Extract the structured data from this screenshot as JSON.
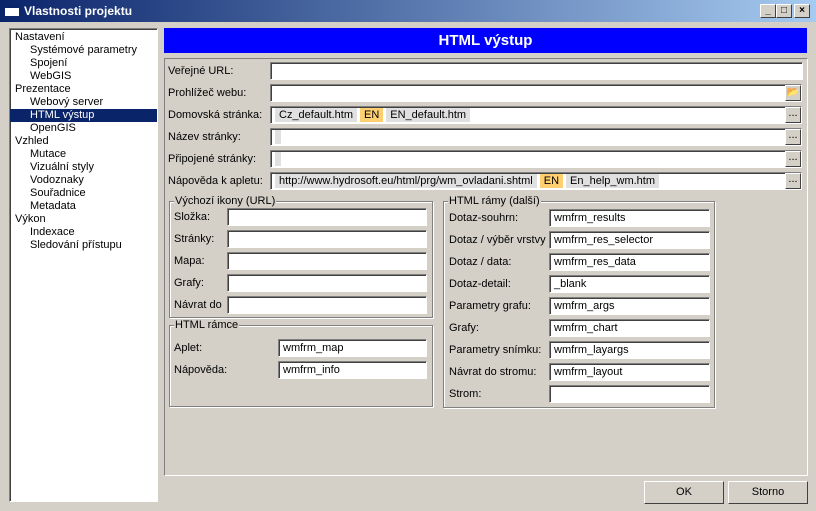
{
  "window": {
    "title": "Vlastnosti projektu",
    "minimize": "_",
    "maximize": "□",
    "close": "×"
  },
  "sidebar": {
    "items": [
      {
        "label": "Nastavení",
        "level": 0
      },
      {
        "label": "Systémové parametry",
        "level": 1
      },
      {
        "label": "Spojení",
        "level": 1
      },
      {
        "label": "WebGIS",
        "level": 1
      },
      {
        "label": "Prezentace",
        "level": 0
      },
      {
        "label": "Webový server",
        "level": 1
      },
      {
        "label": "HTML výstup",
        "level": 1,
        "selected": true
      },
      {
        "label": "OpenGIS",
        "level": 1
      },
      {
        "label": "Vzhled",
        "level": 0
      },
      {
        "label": "Mutace",
        "level": 1
      },
      {
        "label": "Vizuální styly",
        "level": 1
      },
      {
        "label": "Vodoznaky",
        "level": 1
      },
      {
        "label": "Souřadnice",
        "level": 1
      },
      {
        "label": "Metadata",
        "level": 1
      },
      {
        "label": "Výkon",
        "level": 0
      },
      {
        "label": "Indexace",
        "level": 1
      },
      {
        "label": "Sledování přístupu",
        "level": 1
      }
    ]
  },
  "header": {
    "title": "HTML výstup"
  },
  "fields": {
    "public_url": {
      "label": "Veřejné URL:",
      "value": ""
    },
    "browser": {
      "label": "Prohlížeč webu:",
      "value": ""
    },
    "home": {
      "label": "Domovská stránka:",
      "cz": "Cz_default.htm",
      "lang": "EN",
      "en": "EN_default.htm"
    },
    "page_name": {
      "label": "Název stránky:",
      "value": ""
    },
    "attached": {
      "label": "Připojené stránky:",
      "value": ""
    },
    "applet_help": {
      "label": "Nápověda k apletu:",
      "cz": "http://www.hydrosoft.eu/html/prg/wm_ovladani.shtml",
      "lang": "EN",
      "en": "En_help_wm.htm"
    },
    "dots": "..."
  },
  "icons_group": {
    "title": "Výchozí ikony (URL)",
    "rows": [
      {
        "label": "Složka:",
        "value": ""
      },
      {
        "label": "Stránky:",
        "value": ""
      },
      {
        "label": "Mapa:",
        "value": ""
      },
      {
        "label": "Grafy:",
        "value": ""
      },
      {
        "label": "Návrat do",
        "value": ""
      }
    ]
  },
  "frames_group": {
    "title": "HTML rámce",
    "rows": [
      {
        "label": "Aplet:",
        "value": "wmfrm_map"
      },
      {
        "label": "Nápověda:",
        "value": "wmfrm_info"
      }
    ]
  },
  "more_group": {
    "title": "HTML rámy (další)",
    "rows": [
      {
        "label": "Dotaz-souhrn:",
        "value": "wmfrm_results"
      },
      {
        "label": "Dotaz / výběr vrstvy",
        "value": "wmfrm_res_selector"
      },
      {
        "label": "Dotaz / data:",
        "value": "wmfrm_res_data"
      },
      {
        "label": "Dotaz-detail:",
        "value": "_blank"
      },
      {
        "label": "Parametry grafu:",
        "value": "wmfrm_args"
      },
      {
        "label": "Grafy:",
        "value": "wmfrm_chart"
      },
      {
        "label": "Parametry snímku:",
        "value": "wmfrm_layargs"
      },
      {
        "label": "Návrat do stromu:",
        "value": "wmfrm_layout"
      },
      {
        "label": "Strom:",
        "value": ""
      }
    ]
  },
  "buttons": {
    "ok": "OK",
    "cancel": "Storno"
  }
}
